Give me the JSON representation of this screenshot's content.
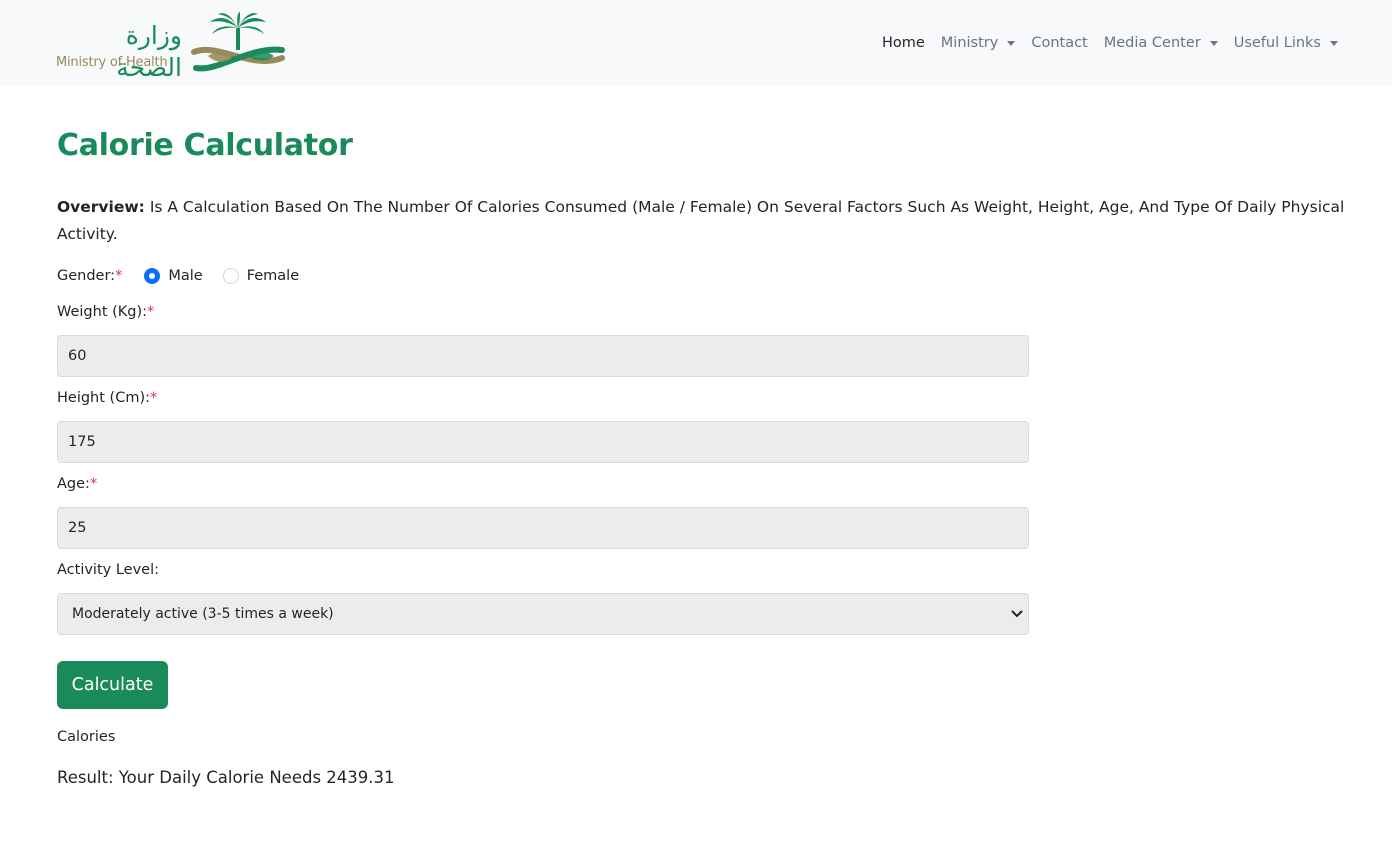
{
  "header": {
    "logo_arabic": "وزارة الصحة",
    "logo_english": "Ministry of Health",
    "nav": [
      {
        "label": "Home"
      },
      {
        "label": "Ministry"
      },
      {
        "label": "Contact"
      },
      {
        "label": "Media Center"
      },
      {
        "label": "Useful Links"
      }
    ]
  },
  "main": {
    "title": "Calorie Calculator",
    "overview_label": "Overview:",
    "overview_text": " Is A Calculation Based On The Number Of Calories Consumed (Male / Female) On Several Factors Such As Weight, Height, Age, And Type Of Daily Physical Activity.",
    "gender": {
      "label": "Gender: ",
      "required_mark": "*",
      "options": [
        {
          "label": "Male",
          "checked": true
        },
        {
          "label": "Female",
          "checked": false
        }
      ]
    },
    "weight": {
      "label": "Weight (Kg):",
      "required_mark": "*",
      "value": "60"
    },
    "height": {
      "label": "Height (Cm):",
      "required_mark": "*",
      "value": "175"
    },
    "age": {
      "label": "Age:",
      "required_mark": "*",
      "value": "25"
    },
    "activity": {
      "label": "Activity Level:",
      "selected": "Moderately active (3-5 times a week)"
    },
    "calculate_label": "Calculate",
    "calories_label": "Calories",
    "result": "Result: Your Daily Calorie Needs 2439.31"
  },
  "colors": {
    "brand_green": "#1b8a5a",
    "logo_gold": "#9a8a5a",
    "radio_blue": "#0d6efd",
    "required_red": "#dc3545"
  },
  "icons": {
    "logo": "palm-tree-and-crossed-swords-emblem",
    "dropdown": "caret-down-icon",
    "select": "chevron-down-icon"
  }
}
